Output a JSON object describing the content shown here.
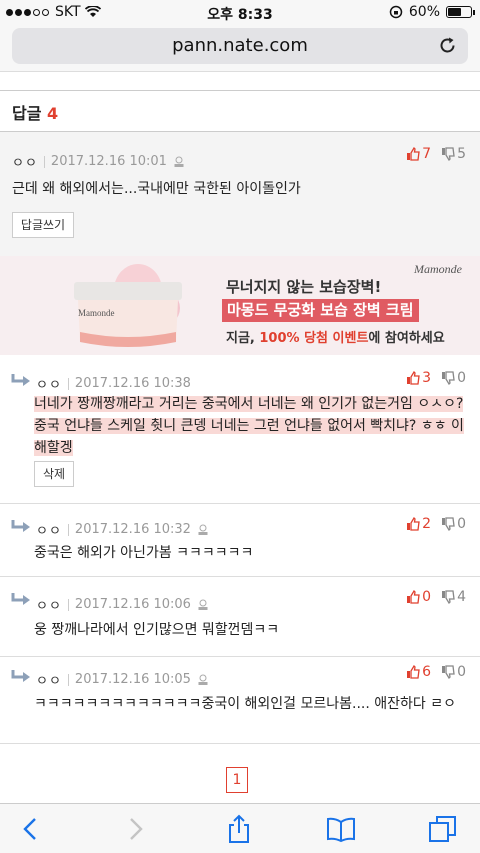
{
  "status": {
    "carrier": "SKT",
    "time": "오후 8:33",
    "battery": "60%",
    "battery_level": 0.6
  },
  "browser": {
    "url": "pann.nate.com"
  },
  "replies": {
    "label": "답글",
    "count": "4"
  },
  "main_comment": {
    "nick": "ㅇㅇ",
    "date": "2017.12.16 10:01",
    "up": "7",
    "down": "5",
    "text": "근데 왜 해외에서는...국내에만 국한된 아이돌인가",
    "reply_button": "답글쓰기"
  },
  "ad": {
    "brand": "Mamonde",
    "jar_brand": "Mamonde",
    "line1": "무너지지 않는 보습장벽!",
    "line2": "마몽드 무궁화 보습 장벽 크림",
    "line3_pre": "지금, ",
    "line3_highlight": "100% 당첨 이벤트",
    "line3_post": "에 참여하세요"
  },
  "subcomments": [
    {
      "nick": "ㅇㅇ",
      "date": "2017.12.16 10:38",
      "up": "3",
      "down": "0",
      "text": "너네가 짱깨짱깨라고 거리는 중국에서 너네는 왜 인기가 없는거임 ㅇㅅㅇ? 중국 언냐들 스케일 췻니 큰뎅 너네는 그런 언냐들 없어서 빡치냐? ㅎㅎ 이해할겡",
      "delete_button": "삭제"
    },
    {
      "nick": "ㅇㅇ",
      "date": "2017.12.16 10:32",
      "up": "2",
      "down": "0",
      "text": "중국은 해외가 아닌가봄 ㅋㅋㅋㅋㅋㅋ"
    },
    {
      "nick": "ㅇㅇ",
      "date": "2017.12.16 10:06",
      "up": "0",
      "down": "4",
      "text": "웅 짱깨나라에서 인기많으면 뭐할껀뎀ㅋㅋ"
    },
    {
      "nick": "ㅇㅇ",
      "date": "2017.12.16 10:05",
      "up": "6",
      "down": "0",
      "text": "ㅋㅋㅋㅋㅋㅋㅋㅋㅋㅋㅋㅋㅋ중국이 해외인걸 모르나봄.... 애잔하다 ㄹㅇ"
    }
  ],
  "pagination": {
    "current": "1"
  },
  "colors": {
    "accent": "#e0402f",
    "highlight": "#f9d9d6"
  }
}
